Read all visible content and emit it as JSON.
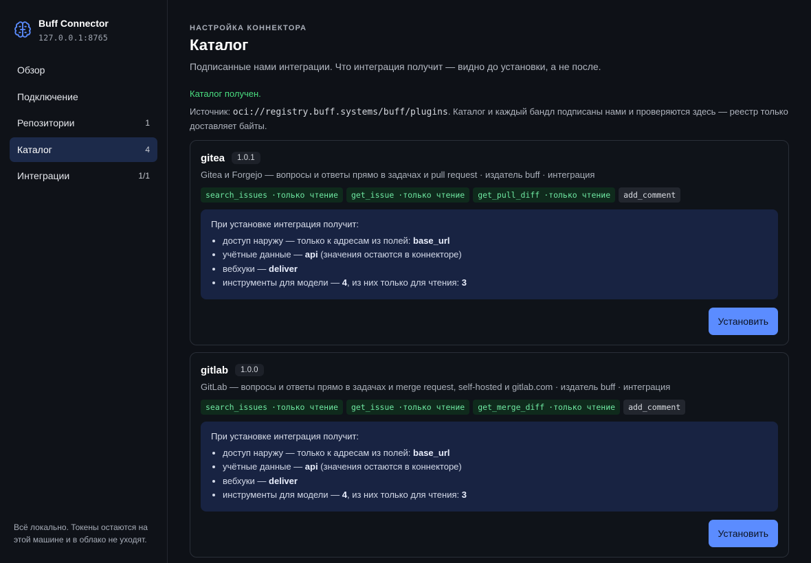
{
  "brand": {
    "name": "Buff Connector",
    "host": "127.0.0.1:8765",
    "icon": "brain-icon",
    "accent": "#5b8cff"
  },
  "nav": [
    {
      "label": "Обзор",
      "count": ""
    },
    {
      "label": "Подключение",
      "count": ""
    },
    {
      "label": "Репозитории",
      "count": "1"
    },
    {
      "label": "Каталог",
      "count": "4",
      "active": true
    },
    {
      "label": "Интеграции",
      "count": "1/1"
    }
  ],
  "sidebar_footer": "Всё локально. Токены остаются на этой машине и в облако не уходят.",
  "page": {
    "eyebrow": "НАСТРОЙКА КОННЕКТОРА",
    "title": "Каталог",
    "subtitle": "Подписанные нами интеграции. Что интеграция получит — видно до установки, а не после.",
    "status": "Каталог получен.",
    "source_prefix": "Источник: ",
    "source_url": "oci://registry.buff.systems/buff/plugins",
    "source_suffix": ". Каталог и каждый бандл подписаны нами и проверяются здесь — реестр только доставляет байты."
  },
  "cards": [
    {
      "name": "gitea",
      "version": "1.0.1",
      "desc": "Gitea и Forgejo — вопросы и ответы прямо в задачах и pull request · издатель buff · интеграция",
      "tools": [
        {
          "name": "search_issues",
          "tag": "·только чтение",
          "readonly": true
        },
        {
          "name": "get_issue",
          "tag": "·только чтение",
          "readonly": true
        },
        {
          "name": "get_pull_diff",
          "tag": "·только чтение",
          "readonly": true
        },
        {
          "name": "add_comment",
          "tag": "",
          "readonly": false
        }
      ],
      "perms_title": "При установке интеграция получит:",
      "perms": {
        "net_prefix": "доступ наружу — только к адресам из полей: ",
        "net_value": "base_url",
        "cred_prefix": "учётные данные — ",
        "cred_value": "api",
        "cred_suffix": " (значения остаются в коннекторе)",
        "hook_prefix": "вебхуки — ",
        "hook_value": "deliver",
        "tools_prefix": "инструменты для модели — ",
        "tools_total": "4",
        "tools_mid": ", из них только для чтения: ",
        "tools_ro": "3"
      },
      "install_label": "Установить"
    },
    {
      "name": "gitlab",
      "version": "1.0.0",
      "desc": "GitLab — вопросы и ответы прямо в задачах и merge request, self-hosted и gitlab.com · издатель buff · интеграция",
      "tools": [
        {
          "name": "search_issues",
          "tag": "·только чтение",
          "readonly": true
        },
        {
          "name": "get_issue",
          "tag": "·только чтение",
          "readonly": true
        },
        {
          "name": "get_merge_diff",
          "tag": "·только чтение",
          "readonly": true
        },
        {
          "name": "add_comment",
          "tag": "",
          "readonly": false
        }
      ],
      "perms_title": "При установке интеграция получит:",
      "perms": {
        "net_prefix": "доступ наружу — только к адресам из полей: ",
        "net_value": "base_url",
        "cred_prefix": "учётные данные — ",
        "cred_value": "api",
        "cred_suffix": " (значения остаются в коннекторе)",
        "hook_prefix": "вебхуки — ",
        "hook_value": "deliver",
        "tools_prefix": "инструменты для модели — ",
        "tools_total": "4",
        "tools_mid": ", из них только для чтения: ",
        "tools_ro": "3"
      },
      "install_label": "Установить"
    }
  ]
}
